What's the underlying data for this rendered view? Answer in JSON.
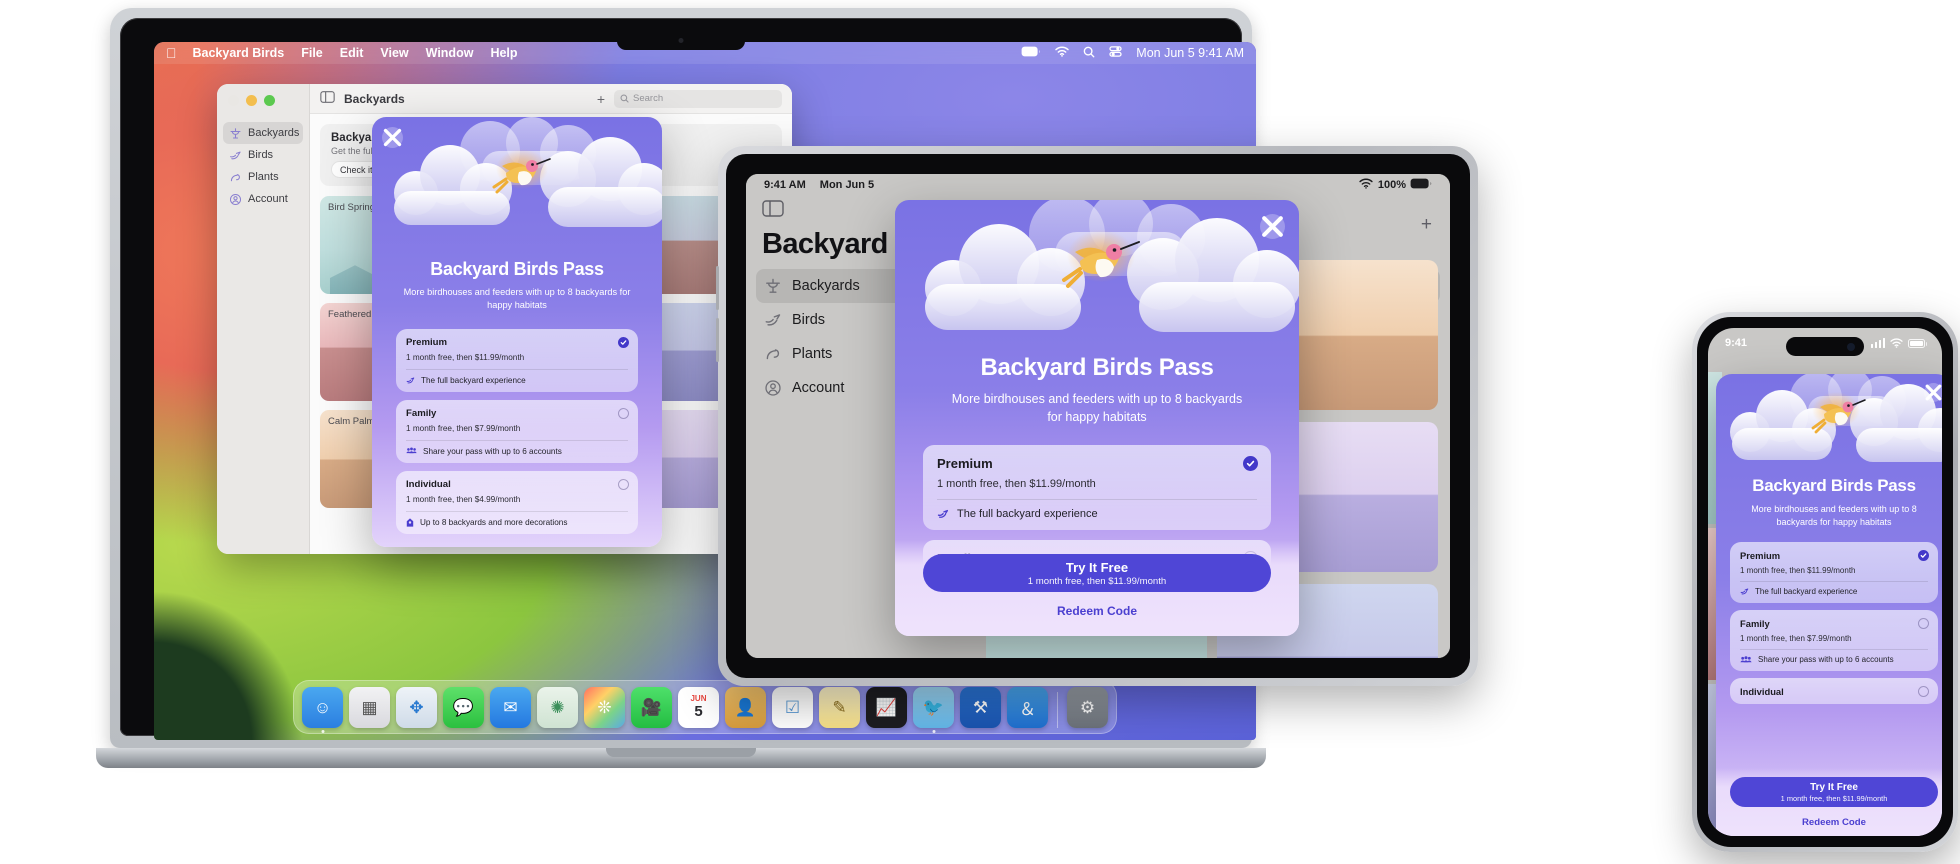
{
  "mac": {
    "menubar": {
      "apple_icon": "apple-logo-icon",
      "app_name": "Backyard Birds",
      "menus": [
        "File",
        "Edit",
        "View",
        "Window",
        "Help"
      ],
      "status_icons": [
        "battery-icon",
        "wifi-icon",
        "search-icon",
        "control-center-icon"
      ],
      "clock": "Mon Jun 5  9:41 AM"
    },
    "window": {
      "title": "Backyards",
      "sidebar_toggle_icon": "sidebar-toggle-icon",
      "add_icon": "plus-icon",
      "search_placeholder": "Search",
      "sidebar": [
        {
          "label": "Backyards",
          "icon": "birdbath-icon",
          "selected": true
        },
        {
          "label": "Birds",
          "icon": "bird-icon",
          "selected": false
        },
        {
          "label": "Plants",
          "icon": "plant-icon",
          "selected": false
        },
        {
          "label": "Account",
          "icon": "account-icon",
          "selected": false
        }
      ],
      "promo": {
        "title": "Backyard Birds Pass",
        "subtitle": "Get the full experience",
        "button": "Check it out",
        "button_icon": "chevron-right-icon"
      },
      "yards": [
        "Bird Springs",
        "Feathered Friends",
        "Calm Palms"
      ]
    },
    "dock": {
      "icons": [
        "finder-icon",
        "launchpad-icon",
        "safari-icon",
        "messages-icon",
        "mail-icon",
        "maps-icon",
        "photos-icon",
        "facetime-icon",
        "calendar-icon",
        "contacts-icon",
        "reminders-icon",
        "notes-icon",
        "stocks-icon",
        "backyard-birds-icon",
        "xcode-icon",
        "appstore-icon",
        "settings-icon"
      ],
      "calendar_month": "JUN",
      "calendar_day": "5"
    }
  },
  "ipad": {
    "status": {
      "time": "9:41 AM",
      "date": "Mon Jun 5",
      "wifi_icon": "wifi-icon",
      "battery_text": "100%",
      "battery_icon": "battery-icon"
    },
    "sidebar_toggle_icon": "sidebar-toggle-icon",
    "title": "Backyard Birds",
    "add_icon": "plus-icon",
    "sidebar": [
      {
        "label": "Backyards",
        "icon": "birdbath-icon",
        "selected": true
      },
      {
        "label": "Birds",
        "icon": "bird-icon",
        "selected": false
      },
      {
        "label": "Plants",
        "icon": "plant-icon",
        "selected": false
      },
      {
        "label": "Account",
        "icon": "account-icon",
        "selected": false
      }
    ],
    "yards": [
      "Calm Palms"
    ]
  },
  "iphone": {
    "status": {
      "time": "9:41",
      "cellular_icon": "cellular-bars-icon",
      "wifi_icon": "wifi-icon",
      "battery_icon": "battery-icon"
    }
  },
  "pass_modal": {
    "close_icon": "close-icon",
    "hero_icon": "hummingbird-illustration",
    "title": "Backyard Birds Pass",
    "subtitle_mac": "More birdhouses and feeders with up to 8 backyards for happy habitats",
    "subtitle_compact": "More birdhouses and feeders with up to 8 backyards for happy habitats",
    "plans": [
      {
        "name": "Premium",
        "price": "1 month free, then $11.99/month",
        "feature": "The full backyard experience",
        "feature_icon": "bird-icon",
        "selected": true
      },
      {
        "name": "Family",
        "price": "1 month free, then $7.99/month",
        "feature": "Share your pass with up to 6 accounts",
        "feature_icon": "people-group-icon",
        "selected": false
      },
      {
        "name": "Individual",
        "price": "1 month free, then $4.99/month",
        "feature": "Up to 8 backyards and more decorations",
        "feature_icon": "birdhouse-icon",
        "selected": false
      }
    ],
    "cta_title": "Try It Free",
    "cta_sub": "1 month free, then $11.99/month",
    "redeem_label": "Redeem Code",
    "colors": {
      "accent": "#4f46d6",
      "modal_top": "#7a72e4",
      "modal_bottom": "#e3d3fb",
      "card": "#e7dbfa"
    }
  }
}
